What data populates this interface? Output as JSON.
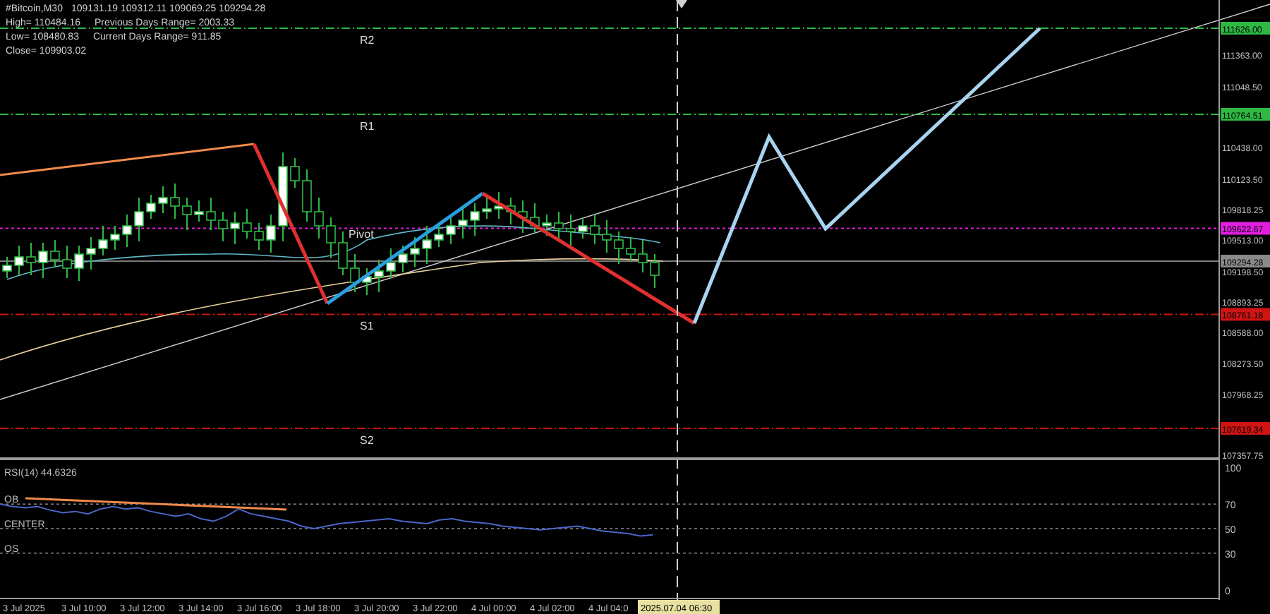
{
  "header": {
    "symbol": "#Bitcoin,M30",
    "ohlc": "109131.19 109312.11 109069.25 109294.28",
    "stats": [
      [
        "High= 110484.16",
        "Previous Days Range= 2003.33"
      ],
      [
        "Low= 108480.83",
        "Current Days Range= 911.85"
      ],
      [
        "Close= 109903.02"
      ]
    ]
  },
  "price_axis": {
    "ticks": [
      "111363.00",
      "111048.50",
      "110438.00",
      "110123.50",
      "109818.25",
      "109513.00",
      "109198.50",
      "108893.25",
      "108588.00",
      "108273.50",
      "107968.25",
      "107357.75"
    ]
  },
  "levels": [
    {
      "label": "R2",
      "price": "111626.00",
      "color": "#2fb844",
      "kind": "dashdot"
    },
    {
      "label": "R1",
      "price": "110764.51",
      "color": "#2fb844",
      "kind": "dashdot"
    },
    {
      "label": "Pivot",
      "price": "109622.67",
      "color": "#e01ee0",
      "kind": "dotted"
    },
    {
      "label": "S1",
      "price": "108761.18",
      "color": "#d01414",
      "kind": "dashdot"
    },
    {
      "label": "S2",
      "price": "107619.34",
      "color": "#d01414",
      "kind": "dashdot"
    }
  ],
  "current_price": {
    "price": "109294.28"
  },
  "rsi": {
    "title": "RSI(14) 44.6326",
    "zones": [
      "OB",
      "CENTER",
      "OS"
    ],
    "axis": [
      "100",
      "70",
      "50",
      "30",
      "0"
    ]
  },
  "time_axis": {
    "labels": [
      "3 Jul 2025",
      "3 Jul 10:00",
      "3 Jul 12:00",
      "3 Jul 14:00",
      "3 Jul 16:00",
      "3 Jul 18:00",
      "3 Jul 20:00",
      "3 Jul 22:00",
      "4 Jul 00:00",
      "4 Jul 02:00",
      "4 Jul 04:0"
    ],
    "cursor": "2025.07.04 06:30"
  }
}
